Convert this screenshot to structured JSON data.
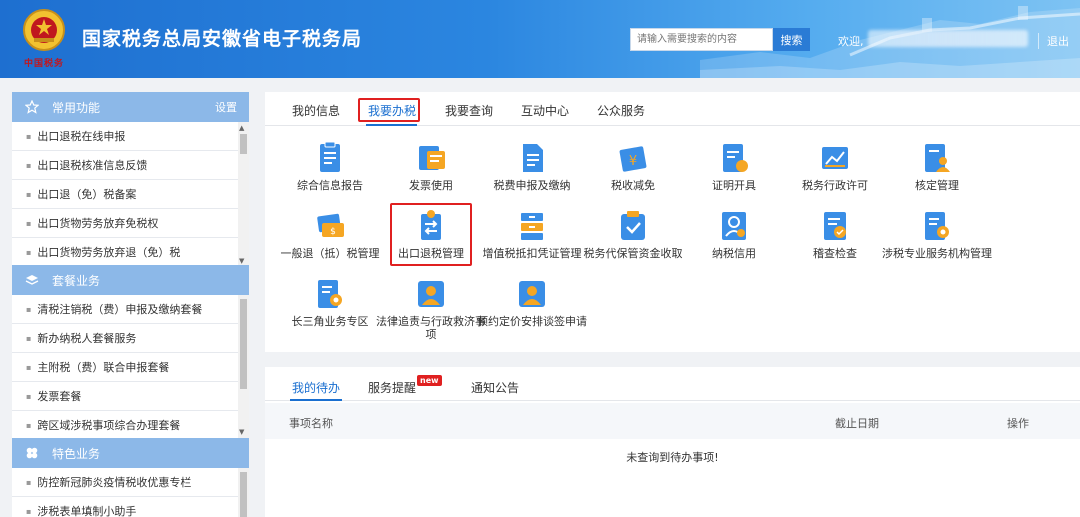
{
  "header": {
    "title": "国家税务总局安徽省电子税务局",
    "emblem_text": "中国税务",
    "search_placeholder": "请输入需要搜索的内容",
    "search_button": "搜索",
    "welcome": "欢迎,",
    "logout": "退出"
  },
  "sidebar": {
    "common": {
      "title": "常用功能",
      "settings": "设置",
      "items": [
        "出口退税在线申报",
        "出口退税核准信息反馈",
        "出口退（免）税备案",
        "出口货物劳务放弃免税权",
        "出口货物劳务放弃退（免）税"
      ]
    },
    "packages": {
      "title": "套餐业务",
      "items": [
        "清税注销税（费）申报及缴纳套餐",
        "新办纳税人套餐服务",
        "主附税（费）联合申报套餐",
        "发票套餐",
        "跨区域涉税事项综合办理套餐"
      ]
    },
    "special": {
      "title": "特色业务",
      "items": [
        "防控新冠肺炎疫情税收优惠专栏",
        "涉税表单填制小助手"
      ]
    }
  },
  "main": {
    "tabs": [
      "我的信息",
      "我要办税",
      "我要查询",
      "互动中心",
      "公众服务"
    ],
    "active_tab": "我要办税",
    "services": [
      {
        "label": "综合信息报告",
        "icon": "document-report-icon"
      },
      {
        "label": "发票使用",
        "icon": "invoice-icon"
      },
      {
        "label": "税费申报及缴纳",
        "icon": "tax-declare-icon"
      },
      {
        "label": "税收减免",
        "icon": "tax-reduction-icon"
      },
      {
        "label": "证明开具",
        "icon": "certificate-icon"
      },
      {
        "label": "税务行政许可",
        "icon": "chart-permit-icon"
      },
      {
        "label": "核定管理",
        "icon": "person-doc-icon"
      },
      {
        "label": "一般退（抵）税管理",
        "icon": "money-refund-icon"
      },
      {
        "label": "出口退税管理",
        "icon": "export-refund-icon"
      },
      {
        "label": "增值税抵扣凭证管理",
        "icon": "vat-voucher-icon"
      },
      {
        "label": "税务代保管资金收取",
        "icon": "custody-check-icon"
      },
      {
        "label": "纳税信用",
        "icon": "credit-icon"
      },
      {
        "label": "稽查检查",
        "icon": "inspection-icon"
      },
      {
        "label": "涉税专业服务机构管理",
        "icon": "agency-gear-icon"
      },
      {
        "label": "长三角业务专区",
        "icon": "region-gear-icon"
      },
      {
        "label": "法律追责与行政救济事项",
        "icon": "legal-person-icon"
      },
      {
        "label": "预约定价安排谈签申请",
        "icon": "appointment-person-icon"
      }
    ]
  },
  "todo": {
    "tabs": [
      "我的待办",
      "服务提醒",
      "通知公告"
    ],
    "badge": "new",
    "columns": [
      "事项名称",
      "截止日期",
      "操作"
    ],
    "empty": "未查询到待办事项!"
  },
  "colors": {
    "accent": "#1a6fd0",
    "icon_blue": "#3a8ee6",
    "highlight": "#e02020",
    "sidebar_head": "#8cb8e8"
  }
}
